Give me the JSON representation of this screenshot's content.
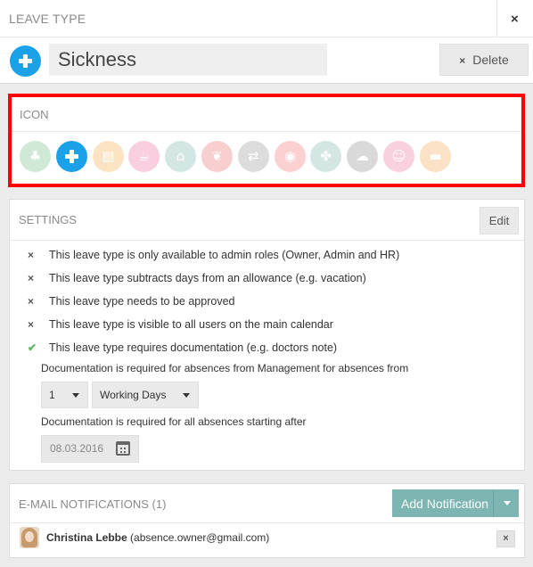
{
  "header": {
    "title": "LEAVE TYPE",
    "close_icon": "×"
  },
  "leave_type": {
    "icon": "plus-icon",
    "icon_color": "#1aa1e8",
    "name_value": "Sickness",
    "delete_label": "Delete",
    "delete_icon": "×"
  },
  "icon_picker": {
    "title": "ICON",
    "selected_index": 1,
    "icons": [
      {
        "name": "palm-tree-icon",
        "glyph": "♣",
        "color": "#cfe9d6"
      },
      {
        "name": "plus-icon",
        "glyph": "+",
        "color": "#1aa1e8"
      },
      {
        "name": "chart-icon",
        "glyph": "▤",
        "color": "#fbe3c4"
      },
      {
        "name": "coffee-icon",
        "glyph": "☕",
        "color": "#f9cfe0"
      },
      {
        "name": "home-icon",
        "glyph": "⌂",
        "color": "#d4e6e4"
      },
      {
        "name": "leaf-icon",
        "glyph": "❦",
        "color": "#f8cfcf"
      },
      {
        "name": "refresh-icon",
        "glyph": "⇄",
        "color": "#dcdcdc"
      },
      {
        "name": "food-icon",
        "glyph": "◉",
        "color": "#fbd0d0"
      },
      {
        "name": "network-icon",
        "glyph": "✤",
        "color": "#d4e6e4"
      },
      {
        "name": "cloud-icon",
        "glyph": "☁",
        "color": "#d9d9d9"
      },
      {
        "name": "baby-icon",
        "glyph": "☺",
        "color": "#f9d0de"
      },
      {
        "name": "car-icon",
        "glyph": "▬",
        "color": "#fbe1c6"
      }
    ]
  },
  "settings": {
    "title": "SETTINGS",
    "edit_label": "Edit",
    "rules": [
      {
        "mark": "×",
        "state": "off",
        "text": "This leave type is only available to admin roles (Owner, Admin and HR)"
      },
      {
        "mark": "×",
        "state": "off",
        "text": "This leave type subtracts days from an allowance (e.g. vacation)"
      },
      {
        "mark": "×",
        "state": "off",
        "text": "This leave type needs to be approved"
      },
      {
        "mark": "×",
        "state": "off",
        "text": "This leave type is visible to all users on the main calendar"
      },
      {
        "mark": "✔",
        "state": "on",
        "text": "This leave type requires documentation (e.g. doctors note)"
      }
    ],
    "doc_management_label": "Documentation is required for absences from Management for absences from",
    "days_count": "1",
    "days_unit": "Working Days",
    "doc_all_label": "Documentation is required for all absences starting after",
    "start_date": "08.03.2016"
  },
  "notifications": {
    "title": "E-MAIL NOTIFICATIONS (1)",
    "add_label": "Add Notification",
    "items": [
      {
        "name": "Christina Lebbe",
        "email": "(absence.owner@gmail.com)"
      }
    ]
  }
}
